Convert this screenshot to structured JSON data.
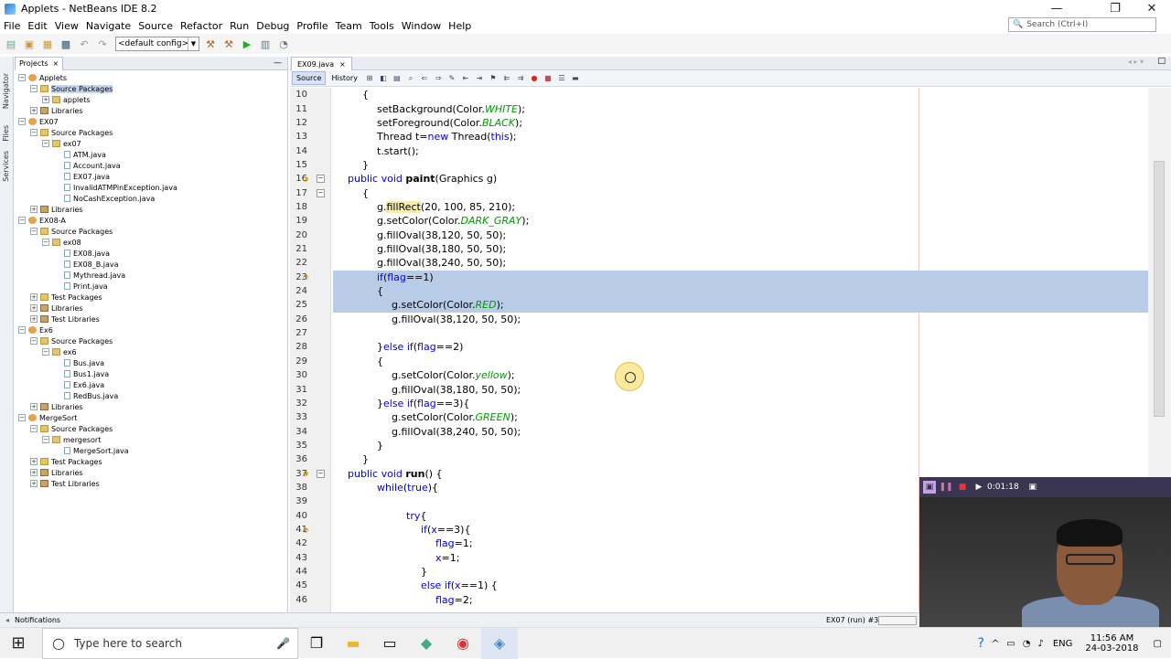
{
  "window": {
    "title": "Applets - NetBeans IDE 8.2",
    "min": "—",
    "max": "❐",
    "close": "✕"
  },
  "menu": [
    "File",
    "Edit",
    "View",
    "Navigate",
    "Source",
    "Refactor",
    "Run",
    "Debug",
    "Profile",
    "Team",
    "Tools",
    "Window",
    "Help"
  ],
  "search": {
    "placeholder": "Search (Ctrl+I)"
  },
  "toolbar": {
    "config": "<default config>"
  },
  "side_labels": [
    "Navigator",
    "Files",
    "Services"
  ],
  "projects": {
    "tab": "Projects",
    "tree": [
      {
        "label": "Applets",
        "depth": 0,
        "type": "proj",
        "exp": "−"
      },
      {
        "label": "Source Packages",
        "depth": 1,
        "type": "pkg",
        "exp": "−",
        "sel": true
      },
      {
        "label": "applets",
        "depth": 2,
        "type": "pkg",
        "exp": "+"
      },
      {
        "label": "Libraries",
        "depth": 1,
        "type": "lib",
        "exp": "+"
      },
      {
        "label": "EX07",
        "depth": 0,
        "type": "proj",
        "exp": "−"
      },
      {
        "label": "Source Packages",
        "depth": 1,
        "type": "pkg",
        "exp": "−"
      },
      {
        "label": "ex07",
        "depth": 2,
        "type": "pkg",
        "exp": "−"
      },
      {
        "label": "ATM.java",
        "depth": 3,
        "type": "java"
      },
      {
        "label": "Account.java",
        "depth": 3,
        "type": "java"
      },
      {
        "label": "EX07.java",
        "depth": 3,
        "type": "java"
      },
      {
        "label": "InvalidATMPinException.java",
        "depth": 3,
        "type": "java"
      },
      {
        "label": "NoCashException.java",
        "depth": 3,
        "type": "java"
      },
      {
        "label": "Libraries",
        "depth": 1,
        "type": "lib",
        "exp": "+"
      },
      {
        "label": "EX08-A",
        "depth": 0,
        "type": "proj",
        "exp": "−"
      },
      {
        "label": "Source Packages",
        "depth": 1,
        "type": "pkg",
        "exp": "−"
      },
      {
        "label": "ex08",
        "depth": 2,
        "type": "pkg",
        "exp": "−"
      },
      {
        "label": "EX08.java",
        "depth": 3,
        "type": "java"
      },
      {
        "label": "EX08_B.java",
        "depth": 3,
        "type": "java"
      },
      {
        "label": "Mythread.java",
        "depth": 3,
        "type": "java"
      },
      {
        "label": "Print.java",
        "depth": 3,
        "type": "java"
      },
      {
        "label": "Test Packages",
        "depth": 1,
        "type": "pkg",
        "exp": "+"
      },
      {
        "label": "Libraries",
        "depth": 1,
        "type": "lib",
        "exp": "+"
      },
      {
        "label": "Test Libraries",
        "depth": 1,
        "type": "lib",
        "exp": "+"
      },
      {
        "label": "Ex6",
        "depth": 0,
        "type": "proj",
        "exp": "−"
      },
      {
        "label": "Source Packages",
        "depth": 1,
        "type": "pkg",
        "exp": "−"
      },
      {
        "label": "ex6",
        "depth": 2,
        "type": "pkg",
        "exp": "−"
      },
      {
        "label": "Bus.java",
        "depth": 3,
        "type": "java"
      },
      {
        "label": "Bus1.java",
        "depth": 3,
        "type": "java"
      },
      {
        "label": "Ex6.java",
        "depth": 3,
        "type": "java"
      },
      {
        "label": "RedBus.java",
        "depth": 3,
        "type": "java"
      },
      {
        "label": "Libraries",
        "depth": 1,
        "type": "lib",
        "exp": "+"
      },
      {
        "label": "MergeSort",
        "depth": 0,
        "type": "proj",
        "exp": "−"
      },
      {
        "label": "Source Packages",
        "depth": 1,
        "type": "pkg",
        "exp": "−"
      },
      {
        "label": "mergesort",
        "depth": 2,
        "type": "pkg",
        "exp": "−"
      },
      {
        "label": "MergeSort.java",
        "depth": 3,
        "type": "java"
      },
      {
        "label": "Test Packages",
        "depth": 1,
        "type": "pkg",
        "exp": "+"
      },
      {
        "label": "Libraries",
        "depth": 1,
        "type": "lib",
        "exp": "+"
      },
      {
        "label": "Test Libraries",
        "depth": 1,
        "type": "lib",
        "exp": "+"
      }
    ]
  },
  "editor": {
    "tab": "EX09.java",
    "modes": [
      "Source",
      "History"
    ],
    "lines": [
      {
        "n": "10",
        "fold": "",
        "mark": "",
        "hl": false,
        "ind": 1,
        "segs": [
          [
            "{",
            ""
          ]
        ]
      },
      {
        "n": "11",
        "fold": "",
        "mark": "",
        "hl": false,
        "ind": 2,
        "segs": [
          [
            "setBackground(Color.",
            ""
          ],
          [
            "WHITE",
            "it"
          ],
          [
            ");",
            ""
          ]
        ]
      },
      {
        "n": "12",
        "fold": "",
        "mark": "",
        "hl": false,
        "ind": 2,
        "segs": [
          [
            "setForeground(Color.",
            ""
          ],
          [
            "BLACK",
            "it"
          ],
          [
            ");",
            ""
          ]
        ]
      },
      {
        "n": "13",
        "fold": "",
        "mark": "",
        "hl": false,
        "ind": 2,
        "segs": [
          [
            "Thread t=",
            ""
          ],
          [
            "new",
            "kw"
          ],
          [
            " Thread(",
            ""
          ],
          [
            "this",
            "kw"
          ],
          [
            ");",
            ""
          ]
        ]
      },
      {
        "n": "14",
        "fold": "",
        "mark": "",
        "hl": false,
        "ind": 2,
        "segs": [
          [
            "t.start();",
            ""
          ]
        ]
      },
      {
        "n": "15",
        "fold": "",
        "mark": "",
        "hl": false,
        "ind": 1,
        "segs": [
          [
            "}",
            ""
          ]
        ]
      },
      {
        "n": "16",
        "fold": "−",
        "mark": "◑",
        "hl": false,
        "ind": 0,
        "segs": [
          [
            "public void ",
            "kw"
          ],
          [
            "paint",
            "bold"
          ],
          [
            "(Graphics g)",
            ""
          ]
        ]
      },
      {
        "n": "17",
        "fold": "−",
        "mark": "",
        "hl": false,
        "ind": 1,
        "segs": [
          [
            "{",
            ""
          ]
        ]
      },
      {
        "n": "18",
        "fold": "",
        "mark": "",
        "hl": false,
        "ind": 2,
        "segs": [
          [
            "g.",
            ""
          ],
          [
            "fillRect",
            "fill"
          ],
          [
            "(20, 100, 85, 210);",
            ""
          ]
        ]
      },
      {
        "n": "19",
        "fold": "",
        "mark": "",
        "hl": false,
        "ind": 2,
        "segs": [
          [
            "g.setColor(Color.",
            ""
          ],
          [
            "DARK_GRAY",
            "it"
          ],
          [
            ");",
            ""
          ]
        ]
      },
      {
        "n": "20",
        "fold": "",
        "mark": "",
        "hl": false,
        "ind": 2,
        "segs": [
          [
            "g.fillOval(38,120, 50, 50);",
            ""
          ]
        ]
      },
      {
        "n": "21",
        "fold": "",
        "mark": "",
        "hl": false,
        "ind": 2,
        "segs": [
          [
            "g.fillOval(38,180, 50, 50);",
            ""
          ]
        ]
      },
      {
        "n": "22",
        "fold": "",
        "mark": "",
        "hl": false,
        "ind": 2,
        "segs": [
          [
            "g.fillOval(38,240, 50, 50);",
            ""
          ]
        ]
      },
      {
        "n": "23",
        "fold": "",
        "mark": "◔",
        "hl": true,
        "ind": 2,
        "segs": [
          [
            "if",
            "kw"
          ],
          [
            "(",
            ""
          ],
          [
            "flag",
            "kw"
          ],
          [
            "==1)",
            ""
          ]
        ]
      },
      {
        "n": "24",
        "fold": "",
        "mark": "",
        "hl": true,
        "ind": 2,
        "segs": [
          [
            "{",
            ""
          ]
        ]
      },
      {
        "n": "25",
        "fold": "",
        "mark": "",
        "hl": true,
        "ind": 3,
        "segs": [
          [
            "g.setColor(Color.",
            ""
          ],
          [
            "RED",
            "it"
          ],
          [
            ");",
            ""
          ]
        ]
      },
      {
        "n": "26",
        "fold": "",
        "mark": "",
        "hl": false,
        "ind": 3,
        "segs": [
          [
            "g.fillOval(38,120, 50, 50);",
            ""
          ]
        ]
      },
      {
        "n": "27",
        "fold": "",
        "mark": "",
        "hl": false,
        "ind": 0,
        "segs": [
          [
            "",
            ""
          ]
        ]
      },
      {
        "n": "28",
        "fold": "",
        "mark": "",
        "hl": false,
        "ind": 2,
        "segs": [
          [
            "}",
            ""
          ],
          [
            "else if",
            "kw"
          ],
          [
            "(",
            ""
          ],
          [
            "flag",
            "kw"
          ],
          [
            "==2)",
            ""
          ]
        ]
      },
      {
        "n": "29",
        "fold": "",
        "mark": "",
        "hl": false,
        "ind": 2,
        "segs": [
          [
            "{",
            ""
          ]
        ]
      },
      {
        "n": "30",
        "fold": "",
        "mark": "",
        "hl": false,
        "ind": 3,
        "segs": [
          [
            "g.setColor(Color.",
            ""
          ],
          [
            "yellow",
            "it"
          ],
          [
            ");",
            ""
          ]
        ]
      },
      {
        "n": "31",
        "fold": "",
        "mark": "",
        "hl": false,
        "ind": 3,
        "segs": [
          [
            "g.fillOval(38,180, 50, 50);",
            ""
          ]
        ]
      },
      {
        "n": "32",
        "fold": "",
        "mark": "",
        "hl": false,
        "ind": 2,
        "segs": [
          [
            "}",
            ""
          ],
          [
            "else if",
            "kw"
          ],
          [
            "(",
            ""
          ],
          [
            "flag",
            "kw"
          ],
          [
            "==3){",
            ""
          ]
        ]
      },
      {
        "n": "33",
        "fold": "",
        "mark": "",
        "hl": false,
        "ind": 3,
        "segs": [
          [
            "g.setColor(Color.",
            ""
          ],
          [
            "GREEN",
            "it"
          ],
          [
            ");",
            ""
          ]
        ]
      },
      {
        "n": "34",
        "fold": "",
        "mark": "",
        "hl": false,
        "ind": 3,
        "segs": [
          [
            "g.fillOval(38,240, 50, 50);",
            ""
          ]
        ]
      },
      {
        "n": "35",
        "fold": "",
        "mark": "",
        "hl": false,
        "ind": 2,
        "segs": [
          [
            "}",
            ""
          ]
        ]
      },
      {
        "n": "36",
        "fold": "",
        "mark": "",
        "hl": false,
        "ind": 1,
        "segs": [
          [
            "}",
            ""
          ]
        ]
      },
      {
        "n": "37",
        "fold": "−",
        "mark": "◑",
        "hl": false,
        "ind": 0,
        "segs": [
          [
            "public void ",
            "kw"
          ],
          [
            "run",
            "bold"
          ],
          [
            "() {",
            ""
          ]
        ]
      },
      {
        "n": "38",
        "fold": "",
        "mark": "",
        "hl": false,
        "ind": 2,
        "segs": [
          [
            "while",
            "kw"
          ],
          [
            "(",
            ""
          ],
          [
            "true",
            "kw"
          ],
          [
            "){",
            ""
          ]
        ]
      },
      {
        "n": "39",
        "fold": "",
        "mark": "",
        "hl": false,
        "ind": 0,
        "segs": [
          [
            "",
            ""
          ]
        ]
      },
      {
        "n": "40",
        "fold": "",
        "mark": "",
        "hl": false,
        "ind": 4,
        "segs": [
          [
            "try",
            "kw"
          ],
          [
            "{",
            ""
          ]
        ]
      },
      {
        "n": "41",
        "fold": "",
        "mark": "◔",
        "hl": false,
        "ind": 5,
        "segs": [
          [
            "if",
            "kw"
          ],
          [
            "(",
            ""
          ],
          [
            "x",
            "kw"
          ],
          [
            "==3){",
            ""
          ]
        ]
      },
      {
        "n": "42",
        "fold": "",
        "mark": "",
        "hl": false,
        "ind": 6,
        "segs": [
          [
            "flag",
            "kw"
          ],
          [
            "=1;",
            ""
          ]
        ]
      },
      {
        "n": "43",
        "fold": "",
        "mark": "",
        "hl": false,
        "ind": 6,
        "segs": [
          [
            "x",
            "kw"
          ],
          [
            "=1;",
            ""
          ]
        ]
      },
      {
        "n": "44",
        "fold": "",
        "mark": "",
        "hl": false,
        "ind": 5,
        "segs": [
          [
            "}",
            ""
          ]
        ]
      },
      {
        "n": "45",
        "fold": "",
        "mark": "",
        "hl": false,
        "ind": 5,
        "segs": [
          [
            "else if",
            "kw"
          ],
          [
            "(",
            ""
          ],
          [
            "x",
            "kw"
          ],
          [
            "==1) {",
            ""
          ]
        ]
      },
      {
        "n": "46",
        "fold": "",
        "mark": "",
        "hl": false,
        "ind": 6,
        "segs": [
          [
            "flag",
            "kw"
          ],
          [
            "=2;",
            ""
          ]
        ]
      }
    ]
  },
  "status": {
    "notifications": "Notifications",
    "run": "EX07 (run) #3"
  },
  "recorder": {
    "time": "0:01:18"
  },
  "taskbar": {
    "search": "Type here to search",
    "lang": "ENG",
    "time": "11:56 AM",
    "date": "24-03-2018"
  }
}
